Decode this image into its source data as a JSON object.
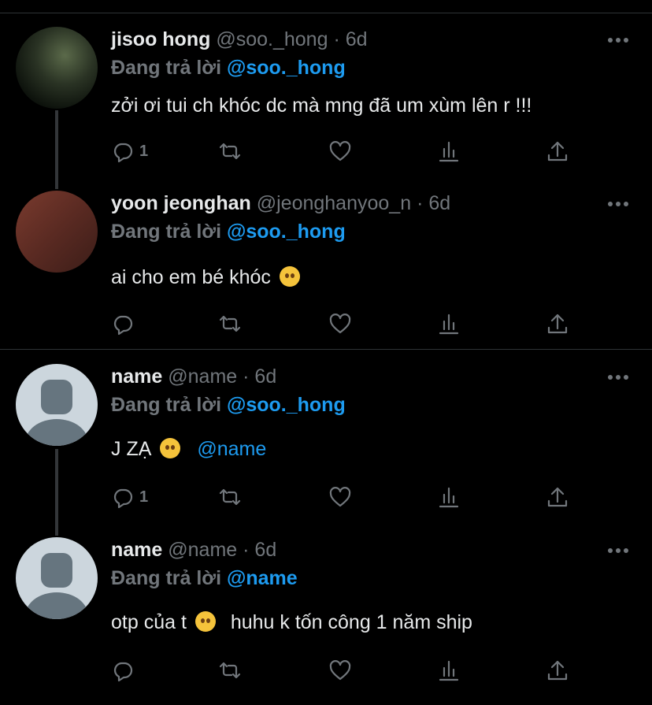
{
  "tweets": [
    {
      "name": "jisoo hong",
      "handle": "@soo._hong",
      "time": "· 6d",
      "replying_prefix": "Đang trả lời ",
      "replying_to": "@soo._hong",
      "text": "zởi ơi tui ch khóc dc mà mng đã um xùm lên r !!!",
      "reply_count": "1"
    },
    {
      "name": "yoon jeonghan",
      "handle": "@jeonghanyoo_n",
      "time": "· 6d",
      "replying_prefix": "Đang trả lời ",
      "replying_to": "@soo._hong",
      "text": "ai cho em bé khóc",
      "emoji": "angry-face-emoji",
      "reply_count": ""
    },
    {
      "name": "name",
      "handle": "@name",
      "time": "· 6d",
      "replying_prefix": "Đang trả lời ",
      "replying_to": "@soo._hong",
      "text": "J ZẠ",
      "emoji": "flushed-face-emoji",
      "mention": "@name",
      "reply_count": "1"
    },
    {
      "name": "name",
      "handle": "@name",
      "time": "· 6d",
      "replying_prefix": "Đang trả lời ",
      "replying_to": "@name",
      "text": "otp của t",
      "emoji": "crying-face-emoji",
      "text_after": "huhu k tốn công 1 năm ship",
      "reply_count": ""
    }
  ],
  "icons": [
    "reply-icon",
    "retweet-icon",
    "like-icon",
    "views-icon",
    "share-icon",
    "more-icon"
  ],
  "colors": {
    "background": "#000000",
    "text": "#e7e9ea",
    "secondary": "#71767b",
    "accent": "#1d9bf0",
    "divider": "#2f3336"
  }
}
